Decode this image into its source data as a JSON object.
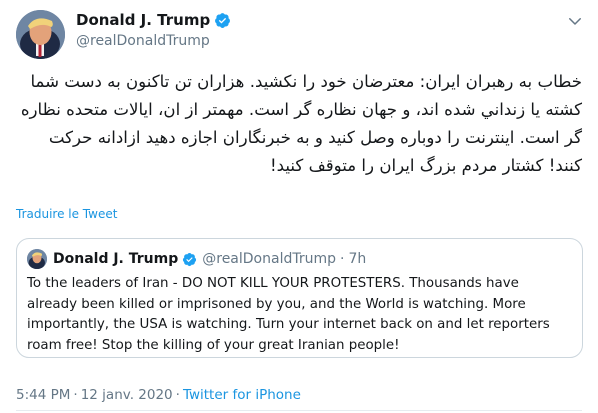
{
  "tweet": {
    "author_name": "Donald J. Trump",
    "author_handle": "@realDonaldTrump",
    "text": "خطاب به رهبران ایران: معترضان خود را نکشید. هزاران تن تاکنون به دست شما کشته یا زنداني شده اند، و جهان نظاره گر است. مهمتر از ان، ايالات متحده نظاره گر است. اينترنت را دوباره وصل کنید و به خبرنگاران اجازه دهید ازادانه حرکت کنند! کشتار مردم بزرگ ایران را متوقف کنید!",
    "translate_label": "Traduire le Tweet",
    "time": "5:44 PM",
    "date": "12 janv. 2020",
    "separator": "·",
    "source": "Twitter for iPhone"
  },
  "quoted": {
    "author_name": "Donald J. Trump",
    "author_handle": "@realDonaldTrump",
    "separator": "·",
    "age": "7h",
    "text": "To the leaders of Iran - DO NOT KILL YOUR PROTESTERS. Thousands have already been killed or imprisoned by you, and the World is watching. More importantly, the USA is watching. Turn your internet back on and let reporters roam free! Stop the killing of your great Iranian people!"
  },
  "icons": {
    "verified": "verified-badge-icon",
    "menu": "chevron-down-icon"
  },
  "colors": {
    "link": "#1b95e0",
    "secondary_text": "#657786",
    "primary_text": "#14171a",
    "border": "#ccd6dd"
  }
}
